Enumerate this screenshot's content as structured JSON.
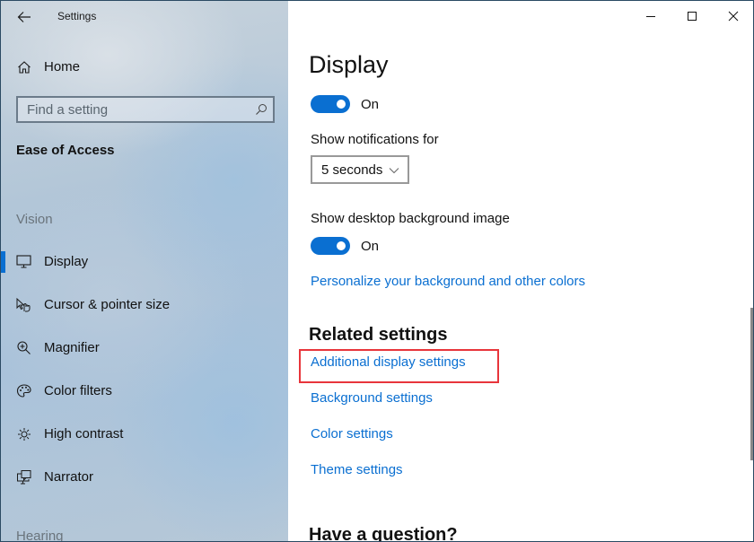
{
  "window": {
    "app_title": "Settings",
    "controls": {
      "minimize": "minimize",
      "maximize": "maximize",
      "close": "close"
    }
  },
  "sidebar": {
    "home_label": "Home",
    "search": {
      "placeholder": "Find a setting",
      "value": ""
    },
    "section_title": "Ease of Access",
    "groups": [
      {
        "label": "Vision",
        "items": [
          {
            "label": "Display",
            "icon": "monitor-icon",
            "selected": true
          },
          {
            "label": "Cursor & pointer size",
            "icon": "pointer-hand-icon",
            "selected": false
          },
          {
            "label": "Magnifier",
            "icon": "magnifier-icon",
            "selected": false
          },
          {
            "label": "Color filters",
            "icon": "palette-icon",
            "selected": false
          },
          {
            "label": "High contrast",
            "icon": "sun-contrast-icon",
            "selected": false
          },
          {
            "label": "Narrator",
            "icon": "narrator-icon",
            "selected": false
          }
        ]
      },
      {
        "label": "Hearing",
        "items": []
      }
    ]
  },
  "main": {
    "page_title": "Display",
    "toggle1": {
      "state": "On",
      "on": true
    },
    "notifications": {
      "label": "Show notifications for",
      "selected": "5 seconds"
    },
    "desktop_background": {
      "label": "Show desktop background image",
      "toggle_state": "On",
      "on": true
    },
    "personalize_link": "Personalize your background and other colors",
    "related": {
      "title": "Related settings",
      "links": [
        "Additional display settings",
        "Background settings",
        "Color settings",
        "Theme settings"
      ],
      "highlighted_link": "Additional display settings"
    },
    "question_title": "Have a question?"
  },
  "colors": {
    "accent": "#0a6fd1",
    "highlight_box": "#e8353b"
  }
}
